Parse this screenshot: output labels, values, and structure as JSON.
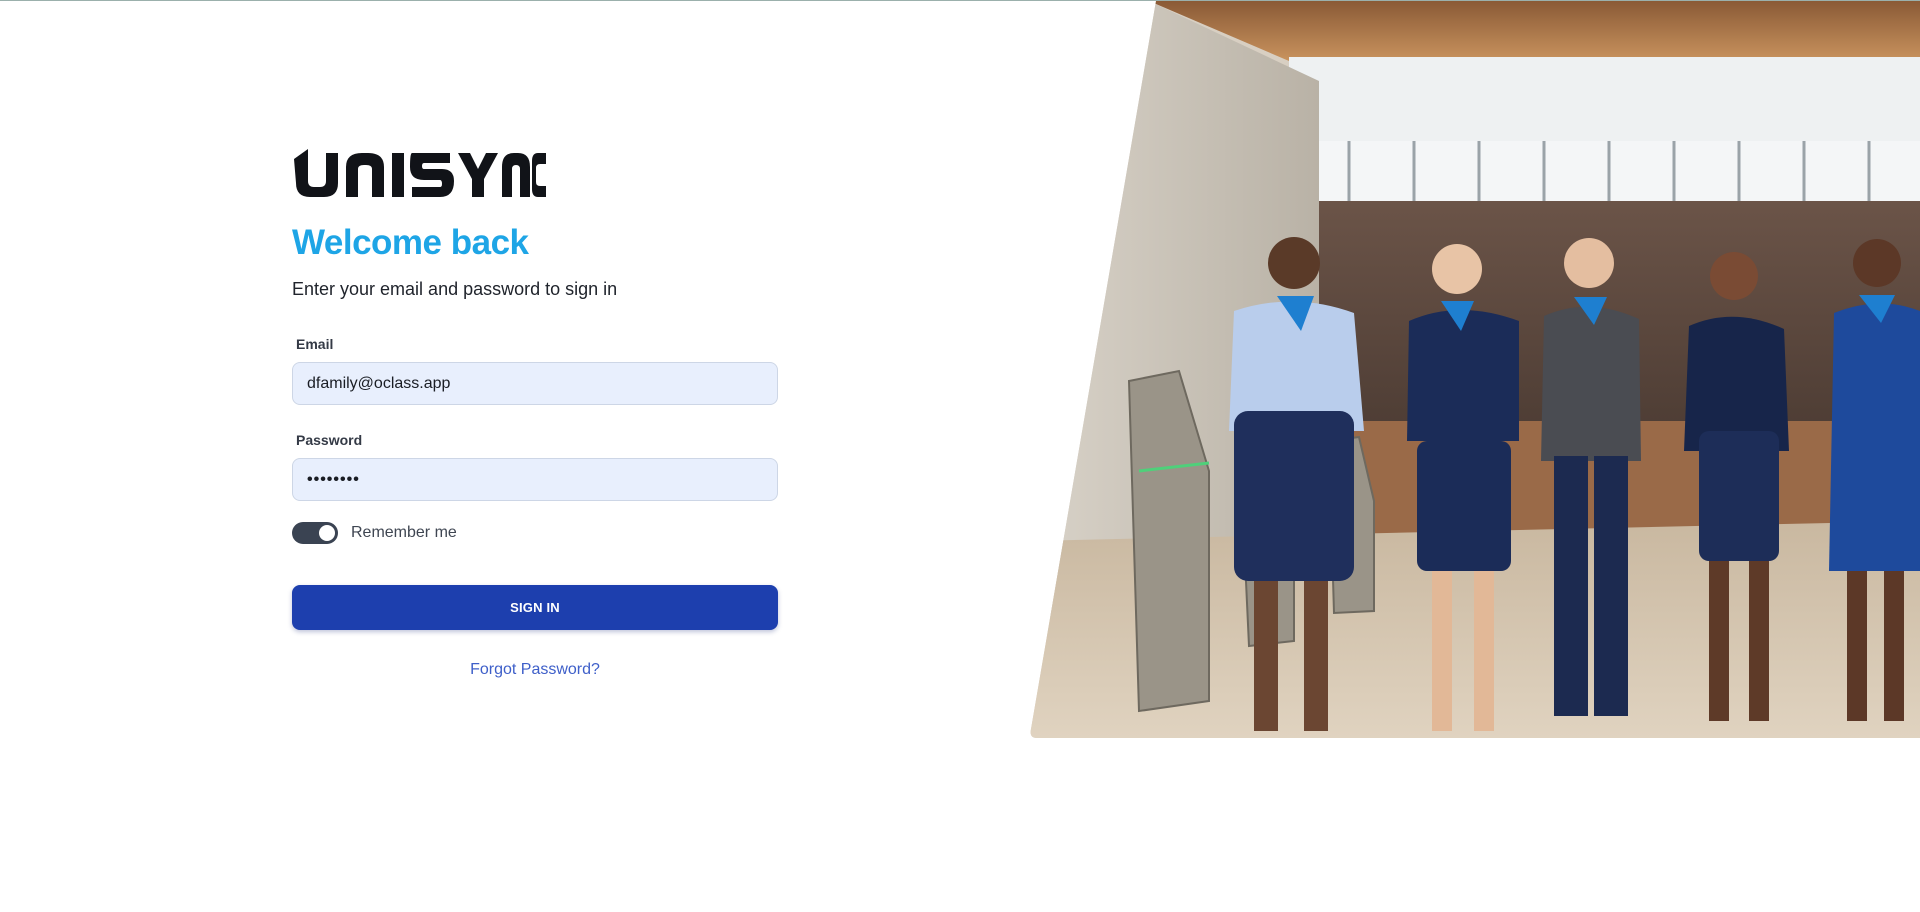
{
  "brand": {
    "logo_text": "UNISYNC"
  },
  "login": {
    "title": "Welcome back",
    "subtitle": "Enter your email and password to sign in",
    "email_label": "Email",
    "email_value": "dfamily@oclass.app",
    "password_label": "Password",
    "password_value": "••••••••",
    "remember_label": "Remember me",
    "remember_checked": true,
    "signin_label": "SIGN IN",
    "forgot_label": "Forgot Password?"
  },
  "colors": {
    "title": "#1ea5e6",
    "button": "#1d3fae",
    "input_bg": "#e8effd",
    "toggle_on": "#3a4352",
    "link": "#3e5fc9"
  },
  "hero": {
    "icon": "flight-attendants-photo"
  }
}
